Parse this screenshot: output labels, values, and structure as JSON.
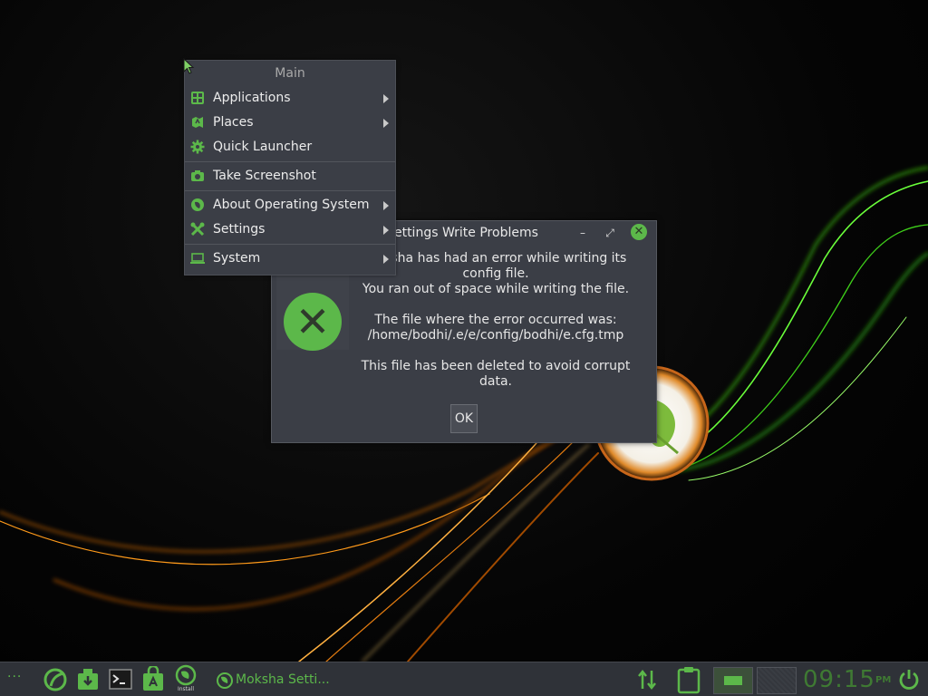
{
  "colors": {
    "accent": "#5cb84a",
    "panel": "#3b3e46",
    "taskbar": "#2f3238",
    "text": "#e6e6e6"
  },
  "dialog": {
    "title": "Settings Write Problems",
    "buttons": {
      "minimize": "–",
      "maximize": "⤢",
      "close": "✕"
    },
    "icon": "error-x-icon",
    "message": {
      "line1": "Moksha has had an error while writing its config file.",
      "line2": "You ran out of space while writing the file.",
      "line3": "The file where the error occurred was:",
      "line4": "/home/bodhi/.e/e/config/bodhi/e.cfg.tmp",
      "line5": "This file has been deleted to avoid corrupt data."
    },
    "ok_label": "OK"
  },
  "menu": {
    "title": "Main",
    "items": [
      {
        "label": "Applications",
        "icon": "applications-icon",
        "submenu": true
      },
      {
        "label": "Places",
        "icon": "places-icon",
        "submenu": true
      },
      {
        "label": "Quick Launcher",
        "icon": "gear-icon",
        "submenu": false
      },
      {
        "label": "Take Screenshot",
        "icon": "camera-icon",
        "submenu": false
      },
      {
        "label": "About Operating System",
        "icon": "bodhi-leaf-icon",
        "submenu": true
      },
      {
        "label": "Settings",
        "icon": "tools-icon",
        "submenu": true
      },
      {
        "label": "System",
        "icon": "laptop-icon",
        "submenu": true
      }
    ]
  },
  "taskbar": {
    "dots": "···",
    "launchers": [
      {
        "name": "start-icon"
      },
      {
        "name": "download-icon"
      },
      {
        "name": "terminal-icon"
      },
      {
        "name": "app-store-icon"
      },
      {
        "name": "install-icon",
        "label": "Install"
      }
    ],
    "task_label": "Moksha Setti...",
    "clock": {
      "time": "09:15",
      "ampm": "PM"
    }
  }
}
